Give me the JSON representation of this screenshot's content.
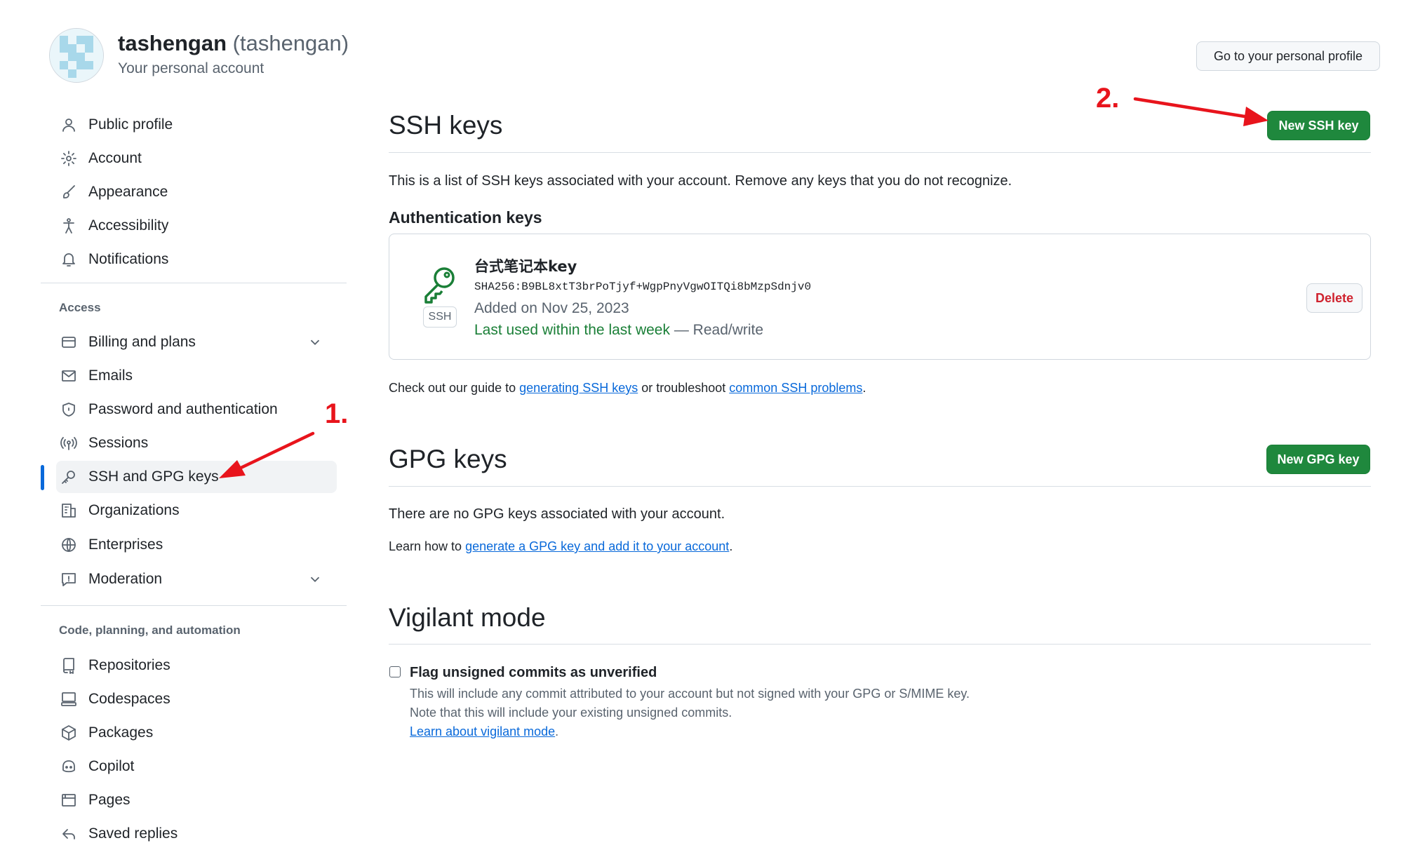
{
  "header": {
    "display_name": "tashengan",
    "login": "(tashengan)",
    "subtitle": "Your personal account",
    "profile_button": "Go to your personal profile"
  },
  "sidebar": {
    "items_top": [
      {
        "label": "Public profile",
        "icon": "person-icon"
      },
      {
        "label": "Account",
        "icon": "gear-icon"
      },
      {
        "label": "Appearance",
        "icon": "paintbrush-icon"
      },
      {
        "label": "Accessibility",
        "icon": "accessibility-icon"
      },
      {
        "label": "Notifications",
        "icon": "bell-icon"
      }
    ],
    "access_heading": "Access",
    "items_access": [
      {
        "label": "Billing and plans",
        "icon": "credit-card-icon"
      },
      {
        "label": "Emails",
        "icon": "mail-icon"
      },
      {
        "label": "Password and authentication",
        "icon": "shield-icon"
      },
      {
        "label": "Sessions",
        "icon": "broadcast-icon"
      },
      {
        "label": "SSH and GPG keys",
        "icon": "key-icon"
      },
      {
        "label": "Organizations",
        "icon": "organization-icon"
      },
      {
        "label": "Enterprises",
        "icon": "globe-icon"
      },
      {
        "label": "Moderation",
        "icon": "report-icon"
      }
    ],
    "code_heading": "Code, planning, and automation",
    "items_code": [
      {
        "label": "Repositories",
        "icon": "repo-icon"
      },
      {
        "label": "Codespaces",
        "icon": "codespaces-icon"
      },
      {
        "label": "Packages",
        "icon": "package-icon"
      },
      {
        "label": "Copilot",
        "icon": "copilot-icon"
      },
      {
        "label": "Pages",
        "icon": "browser-icon"
      },
      {
        "label": "Saved replies",
        "icon": "reply-icon"
      }
    ]
  },
  "ssh": {
    "title": "SSH keys",
    "new_button": "New SSH key",
    "description": "This is a list of SSH keys associated with your account. Remove any keys that you do not recognize.",
    "auth_heading": "Authentication keys",
    "key": {
      "name": "台式笔记本key",
      "fingerprint": "SHA256:B9BL8xtT3brPoTjyf+WgpPnyVgwOITQi8bMzpSdnjv0",
      "badge": "SSH",
      "added": "Added on Nov 25, 2023",
      "last_used": "Last used within the last week",
      "access": " — Read/write",
      "delete_button": "Delete"
    },
    "guide_prefix": "Check out our guide to ",
    "guide_link1": "generating SSH keys",
    "guide_middle": " or troubleshoot ",
    "guide_link2": "common SSH problems",
    "guide_suffix": "."
  },
  "gpg": {
    "title": "GPG keys",
    "new_button": "New GPG key",
    "empty": "There are no GPG keys associated with your account.",
    "learn_prefix": "Learn how to ",
    "learn_link": "generate a GPG key and add it to your account",
    "learn_suffix": "."
  },
  "vigilant": {
    "title": "Vigilant mode",
    "checkbox_label": "Flag unsigned commits as unverified",
    "checked": false,
    "note1": "This will include any commit attributed to your account but not signed with your GPG or S/MIME key.",
    "note2": "Note that this will include your existing unsigned commits.",
    "link": "Learn about vigilant mode",
    "link_suffix": "."
  },
  "annotations": {
    "step1": "1.",
    "step2": "2.",
    "color": "#e8141c"
  },
  "colors": {
    "accent": "#0969da",
    "primary_button": "#1f883d",
    "success_text": "#1a7f37",
    "danger_text": "#cf222e"
  }
}
